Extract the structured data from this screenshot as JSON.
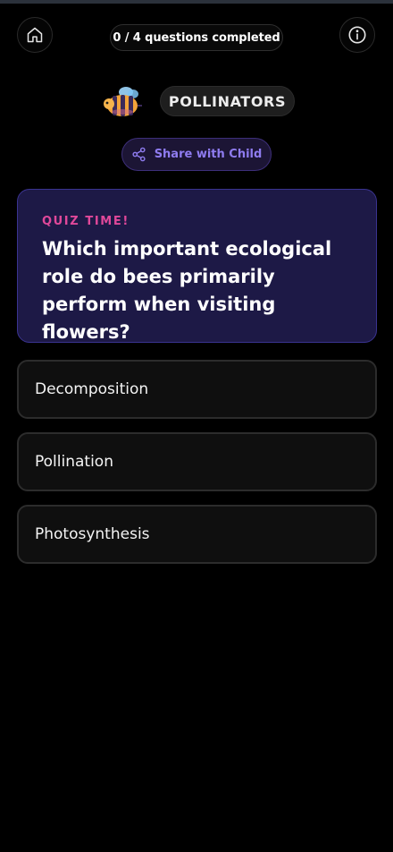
{
  "header": {
    "progress_text": "0 / 4 questions completed",
    "home_icon": "home-icon",
    "info_icon": "info-icon"
  },
  "topic": {
    "mascot_icon": "bee-icon",
    "label": "POLLINATORS"
  },
  "share": {
    "icon": "share-icon",
    "label": "Share with Child"
  },
  "quiz": {
    "label": "QUIZ TIME!",
    "question": "Which important ecological role do bees primarily perform when visiting flowers?",
    "options": [
      {
        "label": "Decomposition"
      },
      {
        "label": "Pollination"
      },
      {
        "label": "Photosynthesis"
      }
    ]
  },
  "colors": {
    "background": "#000000",
    "accent_purple": "#8f7cf0",
    "quiz_label_pink": "#e0489a",
    "quiz_card_bg": "#1d1946"
  }
}
